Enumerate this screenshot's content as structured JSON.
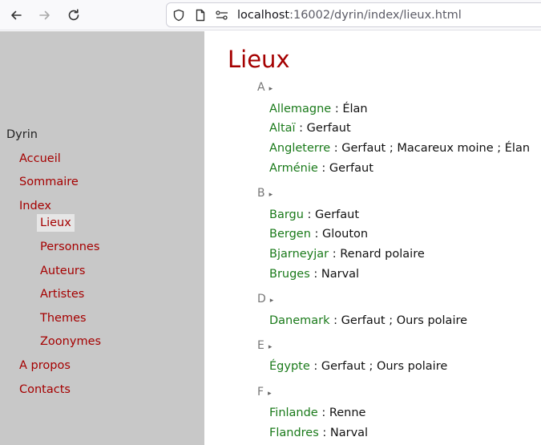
{
  "browser": {
    "url_host": "localhost",
    "url_rest": ":16002/dyrin/index/lieux.html"
  },
  "sidebar": {
    "title": "Dyrin",
    "links": [
      {
        "label": "Accueil"
      },
      {
        "label": "Sommaire"
      },
      {
        "label": "Index"
      },
      {
        "label": "Lieux"
      },
      {
        "label": "Personnes"
      },
      {
        "label": "Auteurs"
      },
      {
        "label": "Artistes"
      },
      {
        "label": "Themes"
      },
      {
        "label": "Zoonymes"
      },
      {
        "label": "A propos"
      },
      {
        "label": "Contacts"
      }
    ]
  },
  "main": {
    "title": "Lieux",
    "toggle_symbol": "▸",
    "groups": [
      {
        "letter": "A",
        "entries": [
          {
            "place": "Allemagne",
            "animals": " : Élan"
          },
          {
            "place": "Altaï",
            "animals": " : Gerfaut"
          },
          {
            "place": "Angleterre",
            "animals": " : Gerfaut ; Macareux moine ; Élan"
          },
          {
            "place": "Arménie",
            "animals": " : Gerfaut"
          }
        ]
      },
      {
        "letter": "B",
        "entries": [
          {
            "place": "Bargu",
            "animals": " : Gerfaut"
          },
          {
            "place": "Bergen",
            "animals": " : Glouton"
          },
          {
            "place": "Bjarneyjar",
            "animals": " : Renard polaire"
          },
          {
            "place": "Bruges",
            "animals": " : Narval"
          }
        ]
      },
      {
        "letter": "D",
        "entries": [
          {
            "place": "Danemark",
            "animals": " : Gerfaut ; Ours polaire"
          }
        ]
      },
      {
        "letter": "E",
        "entries": [
          {
            "place": "Égypte",
            "animals": " : Gerfaut ; Ours polaire"
          }
        ]
      },
      {
        "letter": "F",
        "entries": [
          {
            "place": "Finlande",
            "animals": " : Renne"
          },
          {
            "place": "Flandres",
            "animals": " : Narval"
          }
        ]
      }
    ]
  }
}
